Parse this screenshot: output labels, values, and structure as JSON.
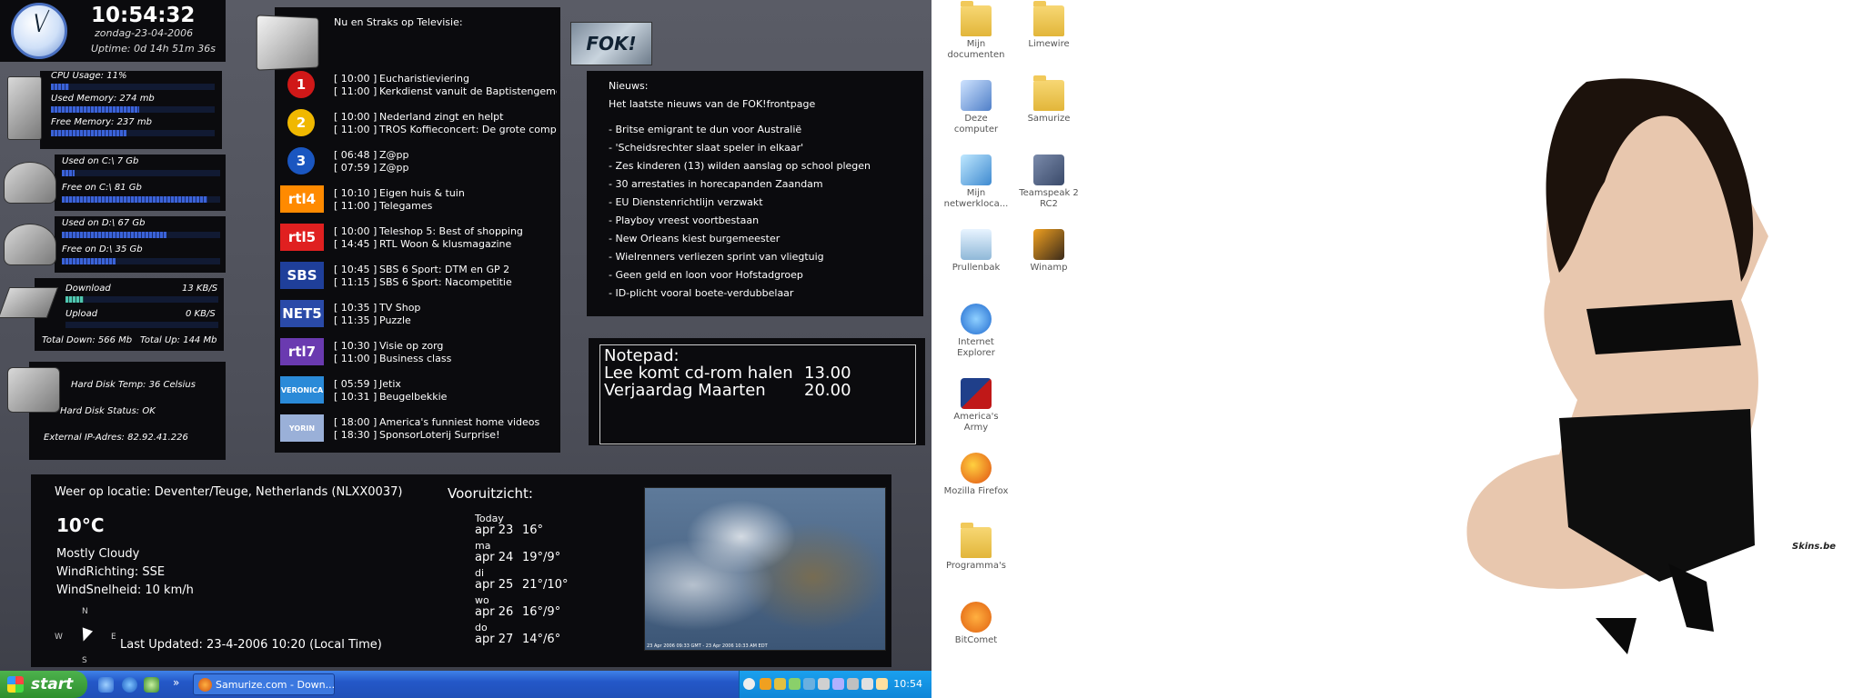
{
  "clock": {
    "time": "10:54:32",
    "date": "zondag-23-04-2006",
    "uptime": "Uptime: 0d 14h 51m 36s"
  },
  "system": {
    "cpu_usage": "CPU Usage: 11%",
    "used_memory": "Used Memory: 274 mb",
    "free_memory": "Free Memory: 237 mb",
    "used_c": "Used on C:\\ 7 Gb",
    "free_c": "Free on C:\\ 81 Gb",
    "used_d": "Used on D:\\ 67 Gb",
    "free_d": "Free on D:\\ 35 Gb",
    "download_label": "Download",
    "download_value": "13 KB/S",
    "upload_label": "Upload",
    "upload_value": "0 KB/S",
    "total_down": "Total Down: 566 Mb",
    "total_up": "Total Up: 144 Mb",
    "hd_temp": "Hard Disk Temp: 36 Celsius",
    "hd_status": "Hard Disk Status: OK",
    "external_ip": "External IP-Adres: 82.92.41.226"
  },
  "tv": {
    "title": "Nu en Straks op Televisie:",
    "channels": [
      {
        "logo": "1",
        "color": "#d01818",
        "lines": [
          [
            "[ 10:00 ]",
            "Eucharistieviering"
          ],
          [
            "[ 11:00 ]",
            "Kerkdienst vanuit de Baptistengemeente"
          ]
        ]
      },
      {
        "logo": "2",
        "color": "#f0b800",
        "lines": [
          [
            "[ 10:00 ]",
            "Nederland zingt en helpt"
          ],
          [
            "[ 11:00 ]",
            "TROS Koffieconcert: De grote componisten"
          ]
        ]
      },
      {
        "logo": "3",
        "color": "#1a56c0",
        "lines": [
          [
            "[ 06:48 ]",
            "Z@pp"
          ],
          [
            "[ 07:59 ]",
            "Z@pp"
          ]
        ]
      },
      {
        "logo": "rtl4",
        "color": "#ff8a00",
        "lines": [
          [
            "[ 10:10 ]",
            "Eigen huis & tuin"
          ],
          [
            "[ 11:00 ]",
            "Telegames"
          ]
        ]
      },
      {
        "logo": "rtl5",
        "color": "#e02020",
        "lines": [
          [
            "[ 10:00 ]",
            "Teleshop 5: Best of shopping"
          ],
          [
            "[ 14:45 ]",
            "RTL Woon & klusmagazine"
          ]
        ]
      },
      {
        "logo": "SBS",
        "color": "#1f3f9a",
        "lines": [
          [
            "[ 10:45 ]",
            "SBS 6 Sport: DTM en GP 2"
          ],
          [
            "[ 11:15 ]",
            "SBS 6 Sport: Nacompetitie"
          ]
        ]
      },
      {
        "logo": "NET5",
        "color": "#2a4aa8",
        "lines": [
          [
            "[ 10:35 ]",
            "TV Shop"
          ],
          [
            "[ 11:35 ]",
            "Puzzle"
          ]
        ]
      },
      {
        "logo": "rtl7",
        "color": "#6a3ab0",
        "lines": [
          [
            "[ 10:30 ]",
            "Visie op zorg"
          ],
          [
            "[ 11:00 ]",
            "Business class"
          ]
        ]
      },
      {
        "logo": "VERONICA",
        "color": "#2a8ad8",
        "lines": [
          [
            "[ 05:59 ]",
            "Jetix"
          ],
          [
            "[ 10:31 ]",
            "Beugelbekkie"
          ]
        ]
      },
      {
        "logo": "YORIN",
        "color": "#9ab0d8",
        "lines": [
          [
            "[ 18:00 ]",
            "America's funniest home videos"
          ],
          [
            "[ 18:30 ]",
            "SponsorLoterij Surprise!"
          ]
        ]
      }
    ]
  },
  "news": {
    "logo": "FOK!",
    "heading": "Nieuws:",
    "subtitle": "Het laatste nieuws van de FOK!frontpage",
    "items": [
      "- Britse emigrant te dun voor Australië",
      "- 'Scheidsrechter slaat speler in elkaar'",
      "- Zes kinderen (13) wilden aanslag op school plegen",
      "- 30 arrestaties in horecapanden Zaandam",
      "- EU Dienstenrichtlijn verzwakt",
      "- Playboy vreest voortbestaan",
      "- New Orleans kiest burgemeester",
      "- Wielrenners verliezen sprint van vliegtuig",
      "- Geen geld en loon voor Hofstadgroep",
      "- ID-plicht vooral boete-verdubbelaar"
    ]
  },
  "notepad": {
    "title": "Notepad:",
    "entries": [
      {
        "text": "Lee komt cd-rom halen",
        "time": "13.00"
      },
      {
        "text": "Verjaardag Maarten",
        "time": "20.00"
      }
    ]
  },
  "weather": {
    "location": "Weer op locatie: Deventer/Teuge, Netherlands (NLXX0037)",
    "temperature": "10°C",
    "condition": "Mostly Cloudy",
    "wind_direction": "WindRichting: SSE",
    "wind_speed": "WindSnelheid: 10 km/h",
    "compass": {
      "n": "N",
      "e": "E",
      "s": "S",
      "w": "W"
    },
    "last_updated": "Last Updated: 23-4-2006 10:20 (Local Time)",
    "forecast_title": "Vooruitzicht:",
    "forecast": [
      {
        "day": "Today",
        "date": "apr 23",
        "temp": "16°"
      },
      {
        "day": "ma",
        "date": "apr 24",
        "temp": "19°/9°"
      },
      {
        "day": "di",
        "date": "apr 25",
        "temp": "21°/10°"
      },
      {
        "day": "wo",
        "date": "apr 26",
        "temp": "16°/9°"
      },
      {
        "day": "do",
        "date": "apr 27",
        "temp": "14°/6°"
      }
    ],
    "map_caption": "23 Apr 2006 09:33 GMT - 23 Apr 2006 10:33 AM EDT"
  },
  "taskbar": {
    "start_label": "start",
    "window_button": "Samurize.com - Down...",
    "clock": "10:54"
  },
  "desktop": {
    "icons": [
      {
        "label": "Mijn documenten",
        "type": "folder"
      },
      {
        "label": "Limewire",
        "type": "folder"
      },
      {
        "label": "Deze computer",
        "type": "computer"
      },
      {
        "label": "Samurize",
        "type": "folder"
      },
      {
        "label": "Mijn netwerkloca...",
        "type": "network"
      },
      {
        "label": "Teamspeak 2 RC2",
        "type": "teamspeak"
      },
      {
        "label": "Prullenbak",
        "type": "recycle"
      },
      {
        "label": "Winamp",
        "type": "winamp"
      },
      {
        "label": "Internet Explorer",
        "type": "ie"
      },
      {
        "label": "America's Army",
        "type": "army"
      },
      {
        "label": "Mozilla Firefox",
        "type": "firefox"
      },
      {
        "label": "Programma's",
        "type": "folder"
      },
      {
        "label": "BitComet",
        "type": "bitcomet"
      }
    ],
    "watermark": "Skins.be"
  }
}
